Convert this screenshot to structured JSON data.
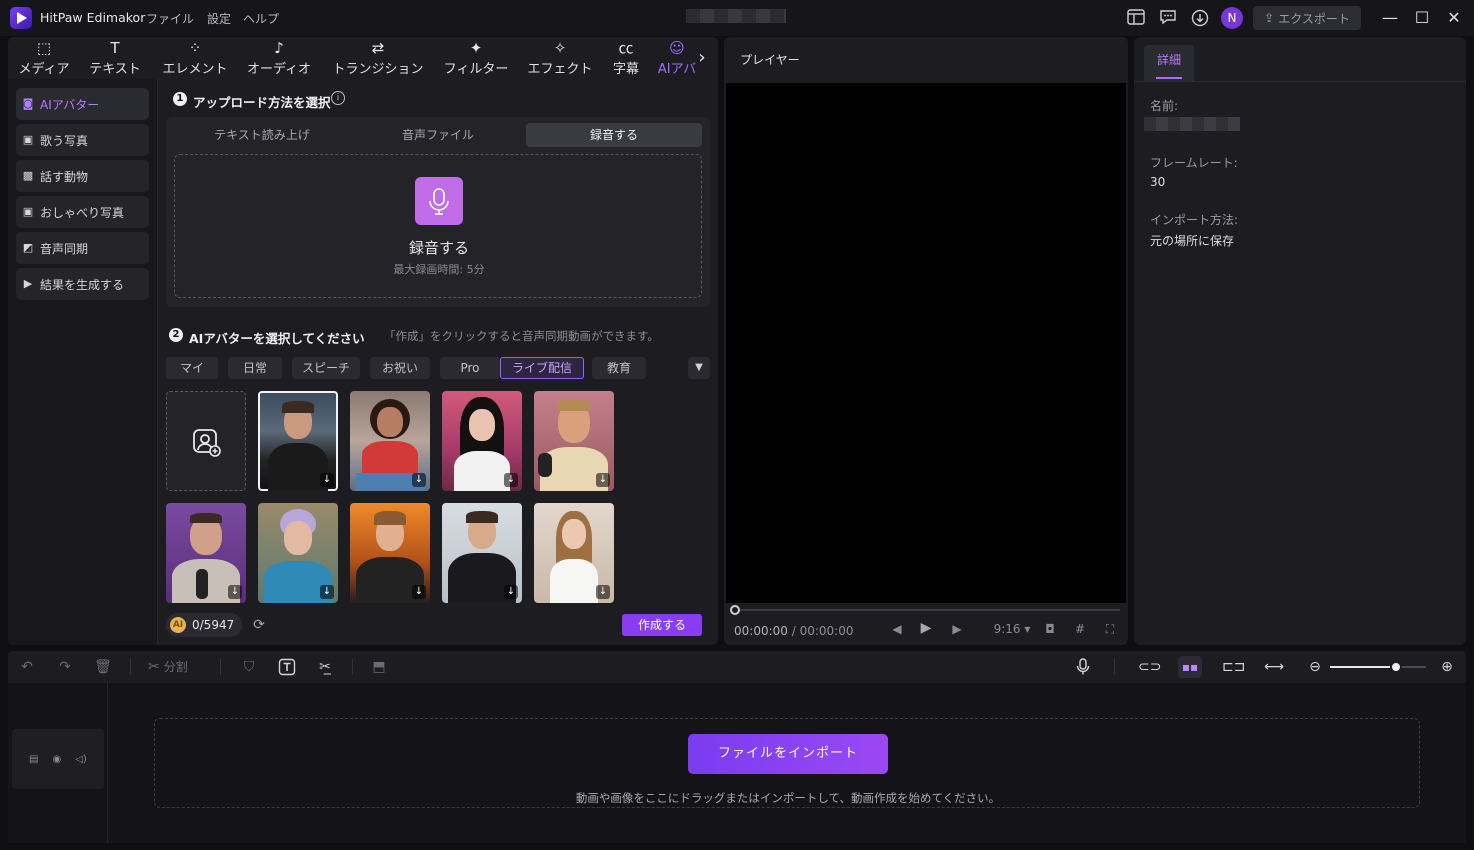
{
  "app": {
    "title": "HitPaw Edimakor",
    "menu": [
      "ファイル",
      "設定",
      "ヘルプ"
    ],
    "avatar_initial": "N",
    "export_label": "エクスポート"
  },
  "tool_tabs": [
    {
      "label": "メディア",
      "icon": "media-icon"
    },
    {
      "label": "テキスト",
      "icon": "text-icon"
    },
    {
      "label": "エレメント",
      "icon": "element-icon"
    },
    {
      "label": "オーディオ",
      "icon": "audio-icon"
    },
    {
      "label": "トランジション",
      "icon": "transition-icon"
    },
    {
      "label": "フィルター",
      "icon": "filter-icon"
    },
    {
      "label": "エフェクト",
      "icon": "effect-icon"
    },
    {
      "label": "字幕",
      "icon": "subtitle-icon"
    },
    {
      "label": "AIアバ",
      "icon": "ai-avatar-icon",
      "active": true
    }
  ],
  "sidebar": {
    "items": [
      {
        "label": "AIアバター",
        "active": true
      },
      {
        "label": "歌う写真"
      },
      {
        "label": "話す動物"
      },
      {
        "label": "おしゃべり写真"
      },
      {
        "label": "音声同期"
      },
      {
        "label": "結果を生成する"
      }
    ]
  },
  "step1": {
    "number": "1",
    "title": "アップロード方法を選択",
    "modes": [
      "テキスト読み上げ",
      "音声ファイル",
      "録音する"
    ],
    "active_mode": "録音する",
    "record_title": "録音する",
    "record_sub": "最大録画時間: 5分"
  },
  "step2": {
    "number": "2",
    "title": "AIアバターを選択してください",
    "hint": "「作成」をクリックすると音声同期動画ができます。",
    "categories": [
      "マイ",
      "日常",
      "スピーチ",
      "お祝い",
      "Pro",
      "ライブ配信",
      "教育"
    ],
    "active_category": "ライブ配信",
    "selected_avatar": 1
  },
  "credits": {
    "value": "0/5947",
    "coin_label": "AI"
  },
  "create_label": "作成する",
  "player": {
    "title": "プレイヤー",
    "time_current": "00:00:00",
    "time_total": "/ 00:00:00",
    "aspect": "9:16"
  },
  "details": {
    "tab": "詳細",
    "name_label": "名前:",
    "framerate_label": "フレームレート:",
    "framerate_value": "30",
    "import_label": "インポート方法:",
    "import_value": "元の場所に保存"
  },
  "toolbar": {
    "split_label": "分割"
  },
  "timeline": {
    "import_label": "ファイルをインポート",
    "drop_hint": "動画や画像をここにドラッグまたはインポートして、動画作成を始めてください。"
  },
  "colors": {
    "accent": "#8a3cf0",
    "accent_light": "#b27dff",
    "background": "#0f0f12",
    "panel": "#1c1c21"
  }
}
